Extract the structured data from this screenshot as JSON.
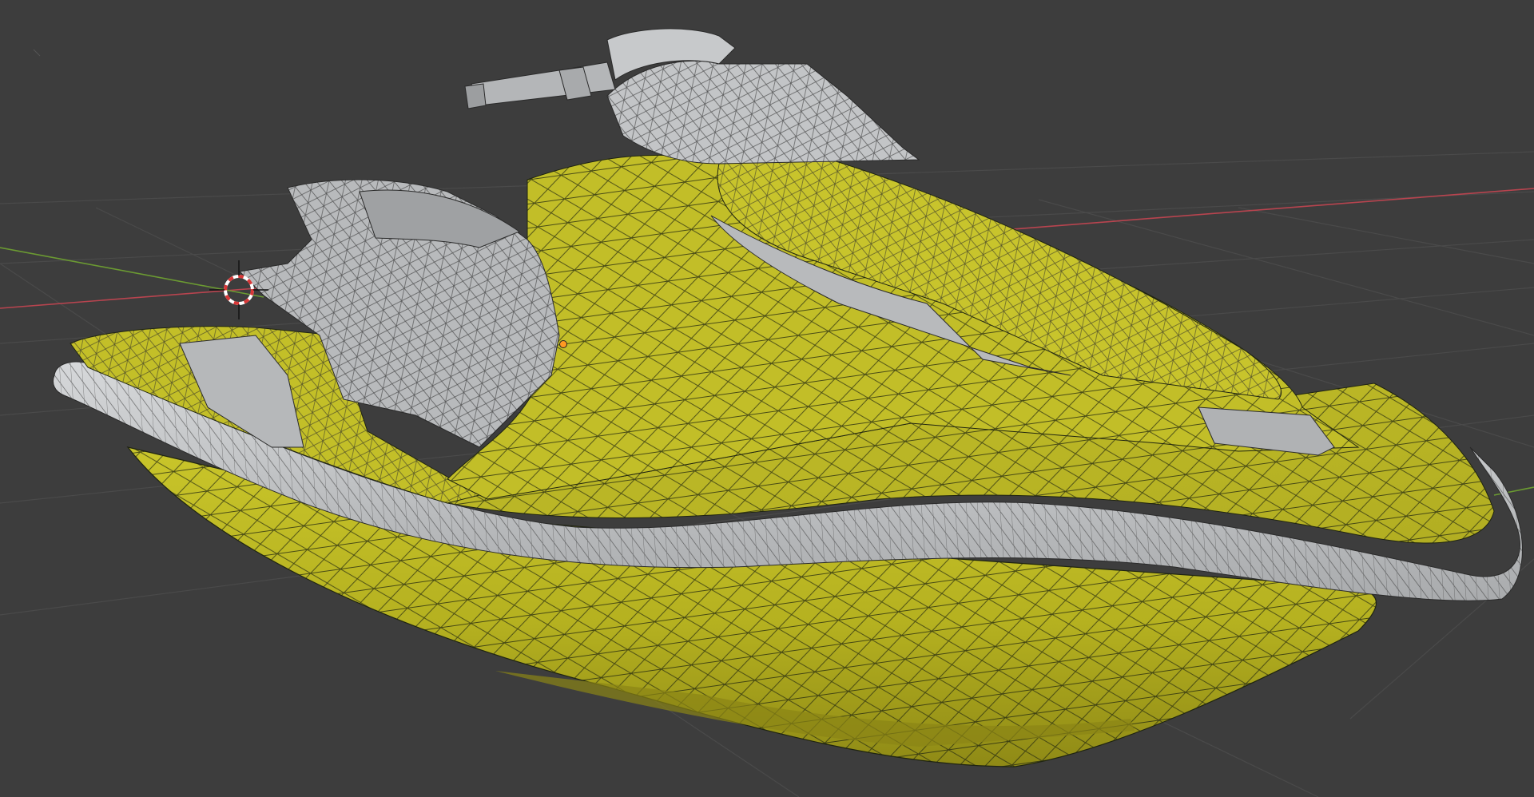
{
  "app": "3D viewport",
  "viewport": {
    "background_color": "#3d3d3d",
    "grid_color": "#4a4a4a",
    "axis_x_color": "#b8444f",
    "axis_y_color": "#6b9a32"
  },
  "object": {
    "body_color": "#bcb924",
    "body_shade_color": "#a9a51c",
    "trim_color": "#c2c4c6",
    "wire_color": "#1f2410",
    "origin_color": "#ff9a22"
  },
  "cursor_3d": {
    "icon": "crosshair-3d-cursor-icon",
    "ring_color_a": "#d83838",
    "ring_color_b": "#ffffff"
  }
}
